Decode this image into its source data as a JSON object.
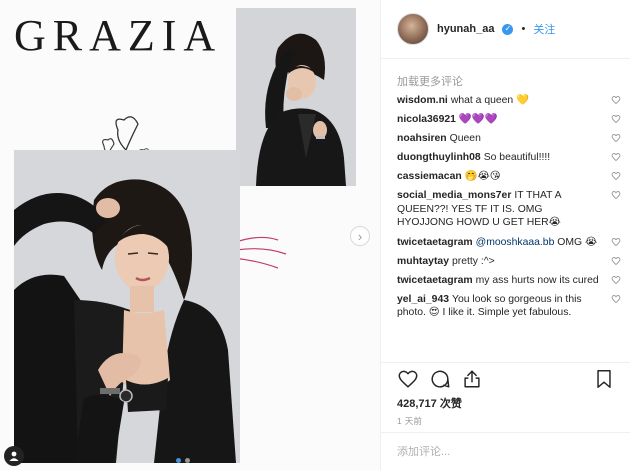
{
  "media": {
    "brand": "GRAZIA",
    "slide_count": 2,
    "active_slide": 0,
    "icons": {
      "next": "chevron-right-icon",
      "tag": "user-tag-icon"
    }
  },
  "header": {
    "username": "hyunah_aa",
    "separator": "•",
    "follow_label": "关注",
    "verified": true
  },
  "load_more_label": "加载更多评论",
  "comments": [
    {
      "author": "wisdom.ni",
      "text": "what a queen 💛"
    },
    {
      "author": "nicola36921",
      "text": "💜💜💜"
    },
    {
      "author": "noahsiren",
      "text": "Queen"
    },
    {
      "author": "duongthuylinh08",
      "text": "So beautiful!!!!"
    },
    {
      "author": "cassiemacan",
      "text": "🤭😭😘"
    },
    {
      "author": "social_media_mons7er",
      "text": "IT THAT A QUEEN??! YES TF IT IS. OMG HYOJJONG HOWD U GET HER😭"
    },
    {
      "author": "twicetaetagram",
      "mention": "@mooshkaaa.bb",
      "text": "OMG 😭"
    },
    {
      "author": "muhtaytay",
      "text": "pretty :^>"
    },
    {
      "author": "twicetaetagram",
      "text": "my ass hurts now its cured"
    },
    {
      "author": "yel_ai_943",
      "text": "You look so gorgeous in this photo. 😍 I like it. Simple yet fabulous."
    }
  ],
  "actions": {
    "like": "heart-icon",
    "comment": "comment-icon",
    "share": "share-icon",
    "save": "bookmark-icon"
  },
  "likes_label": "428,717 次赞",
  "timestamp": "1 天前",
  "add_comment_placeholder": "添加评论...",
  "colors": {
    "accent": "#3897f0",
    "muted": "#999999",
    "text": "#262626"
  }
}
